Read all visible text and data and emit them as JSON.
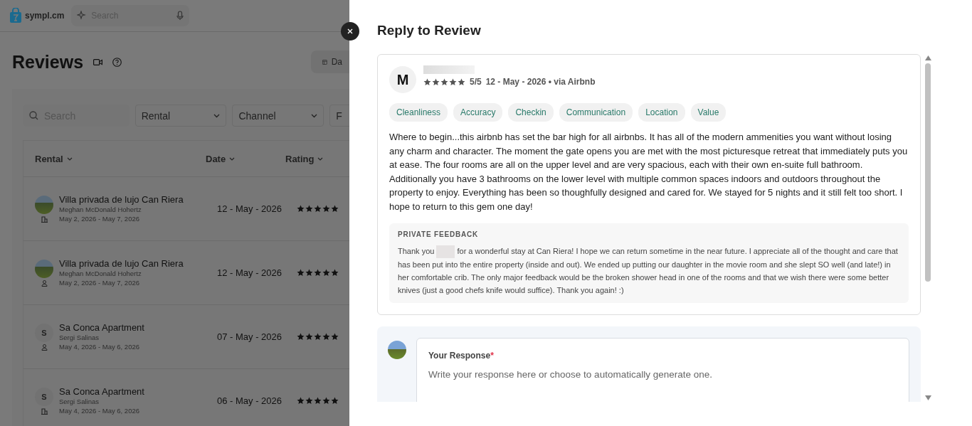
{
  "header": {
    "logo": "sympl.cm",
    "search_placeholder": "Search"
  },
  "page": {
    "title": "Reviews",
    "dashboard_button": "Da"
  },
  "filters": {
    "search_placeholder": "Search",
    "dropdowns": [
      "Rental",
      "Channel",
      "F"
    ]
  },
  "table": {
    "columns": [
      "Rental",
      "Date",
      "Rating"
    ],
    "rows": [
      {
        "rental": "Villa privada de lujo Can Riera",
        "guest": "Meghan McDonald Hohertz",
        "stay": "May 2, 2026 - May 7, 2026",
        "date": "12 - May - 2026",
        "stars": 5,
        "avatar": {
          "kind": "photo"
        },
        "channel_icon": {
          "kind": "home"
        }
      },
      {
        "rental": "Villa privada de lujo Can Riera",
        "guest": "Meghan McDonald Hohertz",
        "stay": "May 2, 2026 - May 7, 2026",
        "date": "12 - May - 2026",
        "stars": 5,
        "avatar": {
          "kind": "photo"
        },
        "channel_icon": {
          "kind": "person"
        }
      },
      {
        "rental": "Sa Conca Apartment",
        "guest": "Sergi Salinas",
        "stay": "May 4, 2026 - May 6, 2026",
        "date": "07 - May - 2026",
        "stars": 5,
        "avatar": {
          "kind": "letter",
          "letter": "S"
        },
        "channel_icon": {
          "kind": "person"
        }
      },
      {
        "rental": "Sa Conca Apartment",
        "guest": "Sergi Salinas",
        "stay": "May 4, 2026 - May 6, 2026",
        "date": "06 - May - 2026",
        "stars": 5,
        "avatar": {
          "kind": "letter",
          "letter": "S"
        },
        "channel_icon": {
          "kind": "home"
        }
      }
    ]
  },
  "drawer": {
    "title": "Reply to Review",
    "review": {
      "avatar_letter": "M",
      "stars": 5,
      "score": "5/5",
      "meta": "12 - May - 2026 • via Airbnb",
      "tags": [
        "Cleanliness",
        "Accuracy",
        "Checkin",
        "Communication",
        "Location",
        "Value"
      ],
      "text": "Where to begin...this airbnb has set the bar high for all airbnbs. It has all of the modern ammenities you want without losing any charm and character. The moment the gate opens you are met with the most picturesque retreat that immediately puts you at ease. The four rooms are all on the upper level and are very spacious, each with their own en-suite full bathroom. Additionally you have 3 bathrooms on the lower level with multiple common spaces indoors and outdoors throughout the property to enjoy. Everything has been so thoughfully designed and cared for. We stayed for 5 nights and it still felt too short. I hope to return to this gem one day!",
      "private_feedback_label": "PRIVATE FEEDBACK",
      "private_feedback_start": "Thank you",
      "private_feedback_rest": "for a wonderful stay at Can Riera! I hope we can return sometime in the near future. I appreciate all of the thought and care that has been put into the entire property (inside and out). We ended up putting our daughter in the movie room and she slept SO well (and late!) in her comfortable crib. The only major feedback would be the broken shower head in one of the rooms and that we wish there were some better knives (just a good chefs knife would suffice). Thank you again! :)"
    },
    "response": {
      "label": "Your Response",
      "required_mark": "*",
      "placeholder": "Write your response here or choose to automatically generate one."
    }
  }
}
